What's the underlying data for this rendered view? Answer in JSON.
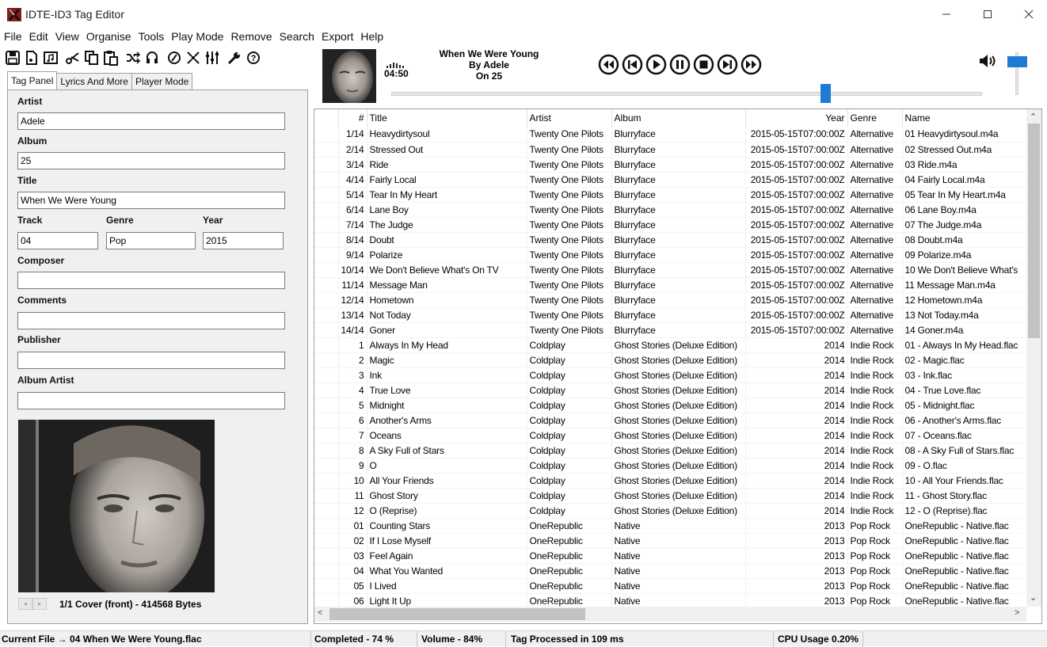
{
  "window": {
    "title": "IDTE-ID3 Tag Editor"
  },
  "menu": [
    "File",
    "Edit",
    "View",
    "Organise",
    "Tools",
    "Play Mode",
    "Remove",
    "Search",
    "Export",
    "Help"
  ],
  "toolbar_icons": [
    "save-icon",
    "new-file-icon",
    "music-file-icon",
    "cut-icon",
    "copy-icon",
    "paste-icon",
    "shuffle-icon",
    "headset-icon",
    "disc-icon",
    "compress-icon",
    "equalizer-icon",
    "wrench-icon",
    "help-icon"
  ],
  "tabs": [
    "Tag Panel",
    "Lyrics And More",
    "Player Mode"
  ],
  "tag_panel": {
    "artist_label": "Artist",
    "artist": "Adele",
    "album_label": "Album",
    "album": "25",
    "title_label": "Title",
    "title": "When We Were Young",
    "track_label": "Track",
    "track": "04",
    "genre_label": "Genre",
    "genre": "Pop",
    "year_label": "Year",
    "year": "2015",
    "composer_label": "Composer",
    "composer": "",
    "comments_label": "Comments",
    "comments": "",
    "publisher_label": "Publisher",
    "publisher": "",
    "album_artist_label": "Album Artist",
    "album_artist": "",
    "cover_caption": "1/1 Cover (front) - 414568 Bytes"
  },
  "player": {
    "time": "04:50",
    "line1": "When We Were Young",
    "line2": "By Adele",
    "line3": "On 25",
    "seek_fraction": 0.74,
    "volume_fraction": 0.84
  },
  "table": {
    "headers": [
      "#",
      "Title",
      "Artist",
      "Album",
      "Year",
      "Genre",
      "Name"
    ],
    "rows": [
      [
        "1/14",
        "Heavydirtysoul",
        "Twenty One Pilots",
        "Blurryface",
        "2015-05-15T07:00:00Z",
        "Alternative",
        "01 Heavydirtysoul.m4a"
      ],
      [
        "2/14",
        "Stressed Out",
        "Twenty One Pilots",
        "Blurryface",
        "2015-05-15T07:00:00Z",
        "Alternative",
        "02 Stressed Out.m4a"
      ],
      [
        "3/14",
        "Ride",
        "Twenty One Pilots",
        "Blurryface",
        "2015-05-15T07:00:00Z",
        "Alternative",
        "03 Ride.m4a"
      ],
      [
        "4/14",
        "Fairly Local",
        "Twenty One Pilots",
        "Blurryface",
        "2015-05-15T07:00:00Z",
        "Alternative",
        "04 Fairly Local.m4a"
      ],
      [
        "5/14",
        "Tear In My Heart",
        "Twenty One Pilots",
        "Blurryface",
        "2015-05-15T07:00:00Z",
        "Alternative",
        "05 Tear In My Heart.m4a"
      ],
      [
        "6/14",
        "Lane Boy",
        "Twenty One Pilots",
        "Blurryface",
        "2015-05-15T07:00:00Z",
        "Alternative",
        "06 Lane Boy.m4a"
      ],
      [
        "7/14",
        "The Judge",
        "Twenty One Pilots",
        "Blurryface",
        "2015-05-15T07:00:00Z",
        "Alternative",
        "07 The Judge.m4a"
      ],
      [
        "8/14",
        "Doubt",
        "Twenty One Pilots",
        "Blurryface",
        "2015-05-15T07:00:00Z",
        "Alternative",
        "08 Doubt.m4a"
      ],
      [
        "9/14",
        "Polarize",
        "Twenty One Pilots",
        "Blurryface",
        "2015-05-15T07:00:00Z",
        "Alternative",
        "09 Polarize.m4a"
      ],
      [
        "10/14",
        "We Don't Believe What's On TV",
        "Twenty One Pilots",
        "Blurryface",
        "2015-05-15T07:00:00Z",
        "Alternative",
        "10 We Don't Believe What's"
      ],
      [
        "11/14",
        "Message Man",
        "Twenty One Pilots",
        "Blurryface",
        "2015-05-15T07:00:00Z",
        "Alternative",
        "11 Message Man.m4a"
      ],
      [
        "12/14",
        "Hometown",
        "Twenty One Pilots",
        "Blurryface",
        "2015-05-15T07:00:00Z",
        "Alternative",
        "12 Hometown.m4a"
      ],
      [
        "13/14",
        "Not Today",
        "Twenty One Pilots",
        "Blurryface",
        "2015-05-15T07:00:00Z",
        "Alternative",
        "13 Not Today.m4a"
      ],
      [
        "14/14",
        "Goner",
        "Twenty One Pilots",
        "Blurryface",
        "2015-05-15T07:00:00Z",
        "Alternative",
        "14 Goner.m4a"
      ],
      [
        "1",
        "Always In My Head",
        "Coldplay",
        "Ghost Stories (Deluxe Edition)",
        "2014",
        "Indie Rock",
        "01 - Always In My Head.flac"
      ],
      [
        "2",
        "Magic",
        "Coldplay",
        "Ghost Stories (Deluxe Edition)",
        "2014",
        "Indie Rock",
        "02 - Magic.flac"
      ],
      [
        "3",
        "Ink",
        "Coldplay",
        "Ghost Stories (Deluxe Edition)",
        "2014",
        "Indie Rock",
        "03 - Ink.flac"
      ],
      [
        "4",
        "True Love",
        "Coldplay",
        "Ghost Stories (Deluxe Edition)",
        "2014",
        "Indie Rock",
        "04 - True Love.flac"
      ],
      [
        "5",
        "Midnight",
        "Coldplay",
        "Ghost Stories (Deluxe Edition)",
        "2014",
        "Indie Rock",
        "05 - Midnight.flac"
      ],
      [
        "6",
        "Another's Arms",
        "Coldplay",
        "Ghost Stories (Deluxe Edition)",
        "2014",
        "Indie Rock",
        "06 - Another's Arms.flac"
      ],
      [
        "7",
        "Oceans",
        "Coldplay",
        "Ghost Stories (Deluxe Edition)",
        "2014",
        "Indie Rock",
        "07 - Oceans.flac"
      ],
      [
        "8",
        "A Sky Full of Stars",
        "Coldplay",
        "Ghost Stories (Deluxe Edition)",
        "2014",
        "Indie Rock",
        "08 - A Sky Full of Stars.flac"
      ],
      [
        "9",
        "O",
        "Coldplay",
        "Ghost Stories (Deluxe Edition)",
        "2014",
        "Indie Rock",
        "09 - O.flac"
      ],
      [
        "10",
        "All Your Friends",
        "Coldplay",
        "Ghost Stories (Deluxe Edition)",
        "2014",
        "Indie Rock",
        "10 - All Your Friends.flac"
      ],
      [
        "11",
        "Ghost Story",
        "Coldplay",
        "Ghost Stories (Deluxe Edition)",
        "2014",
        "Indie Rock",
        "11 - Ghost Story.flac"
      ],
      [
        "12",
        "O (Reprise)",
        "Coldplay",
        "Ghost Stories (Deluxe Edition)",
        "2014",
        "Indie Rock",
        "12 - O (Reprise).flac"
      ],
      [
        "01",
        "Counting Stars",
        "OneRepublic",
        "Native",
        "2013",
        "Pop Rock",
        "OneRepublic - Native.flac"
      ],
      [
        "02",
        "If I Lose Myself",
        "OneRepublic",
        "Native",
        "2013",
        "Pop Rock",
        "OneRepublic - Native.flac"
      ],
      [
        "03",
        "Feel Again",
        "OneRepublic",
        "Native",
        "2013",
        "Pop Rock",
        "OneRepublic - Native.flac"
      ],
      [
        "04",
        "What You Wanted",
        "OneRepublic",
        "Native",
        "2013",
        "Pop Rock",
        "OneRepublic - Native.flac"
      ],
      [
        "05",
        "I Lived",
        "OneRepublic",
        "Native",
        "2013",
        "Pop Rock",
        "OneRepublic - Native.flac"
      ],
      [
        "06",
        "Light It Up",
        "OneRepublic",
        "Native",
        "2013",
        "Pop Rock",
        "OneRepublic - Native.flac"
      ]
    ]
  },
  "status": {
    "current_file": "Current File → 04 When We Were Young.flac",
    "completed": "Completed - 74 %",
    "volume": "Volume - 84%",
    "processed": "Tag Processed in 109 ms",
    "cpu": "CPU Usage 0.20%"
  },
  "colors": {
    "accent": "#1e7bd4",
    "panel": "#f0f0f0"
  }
}
